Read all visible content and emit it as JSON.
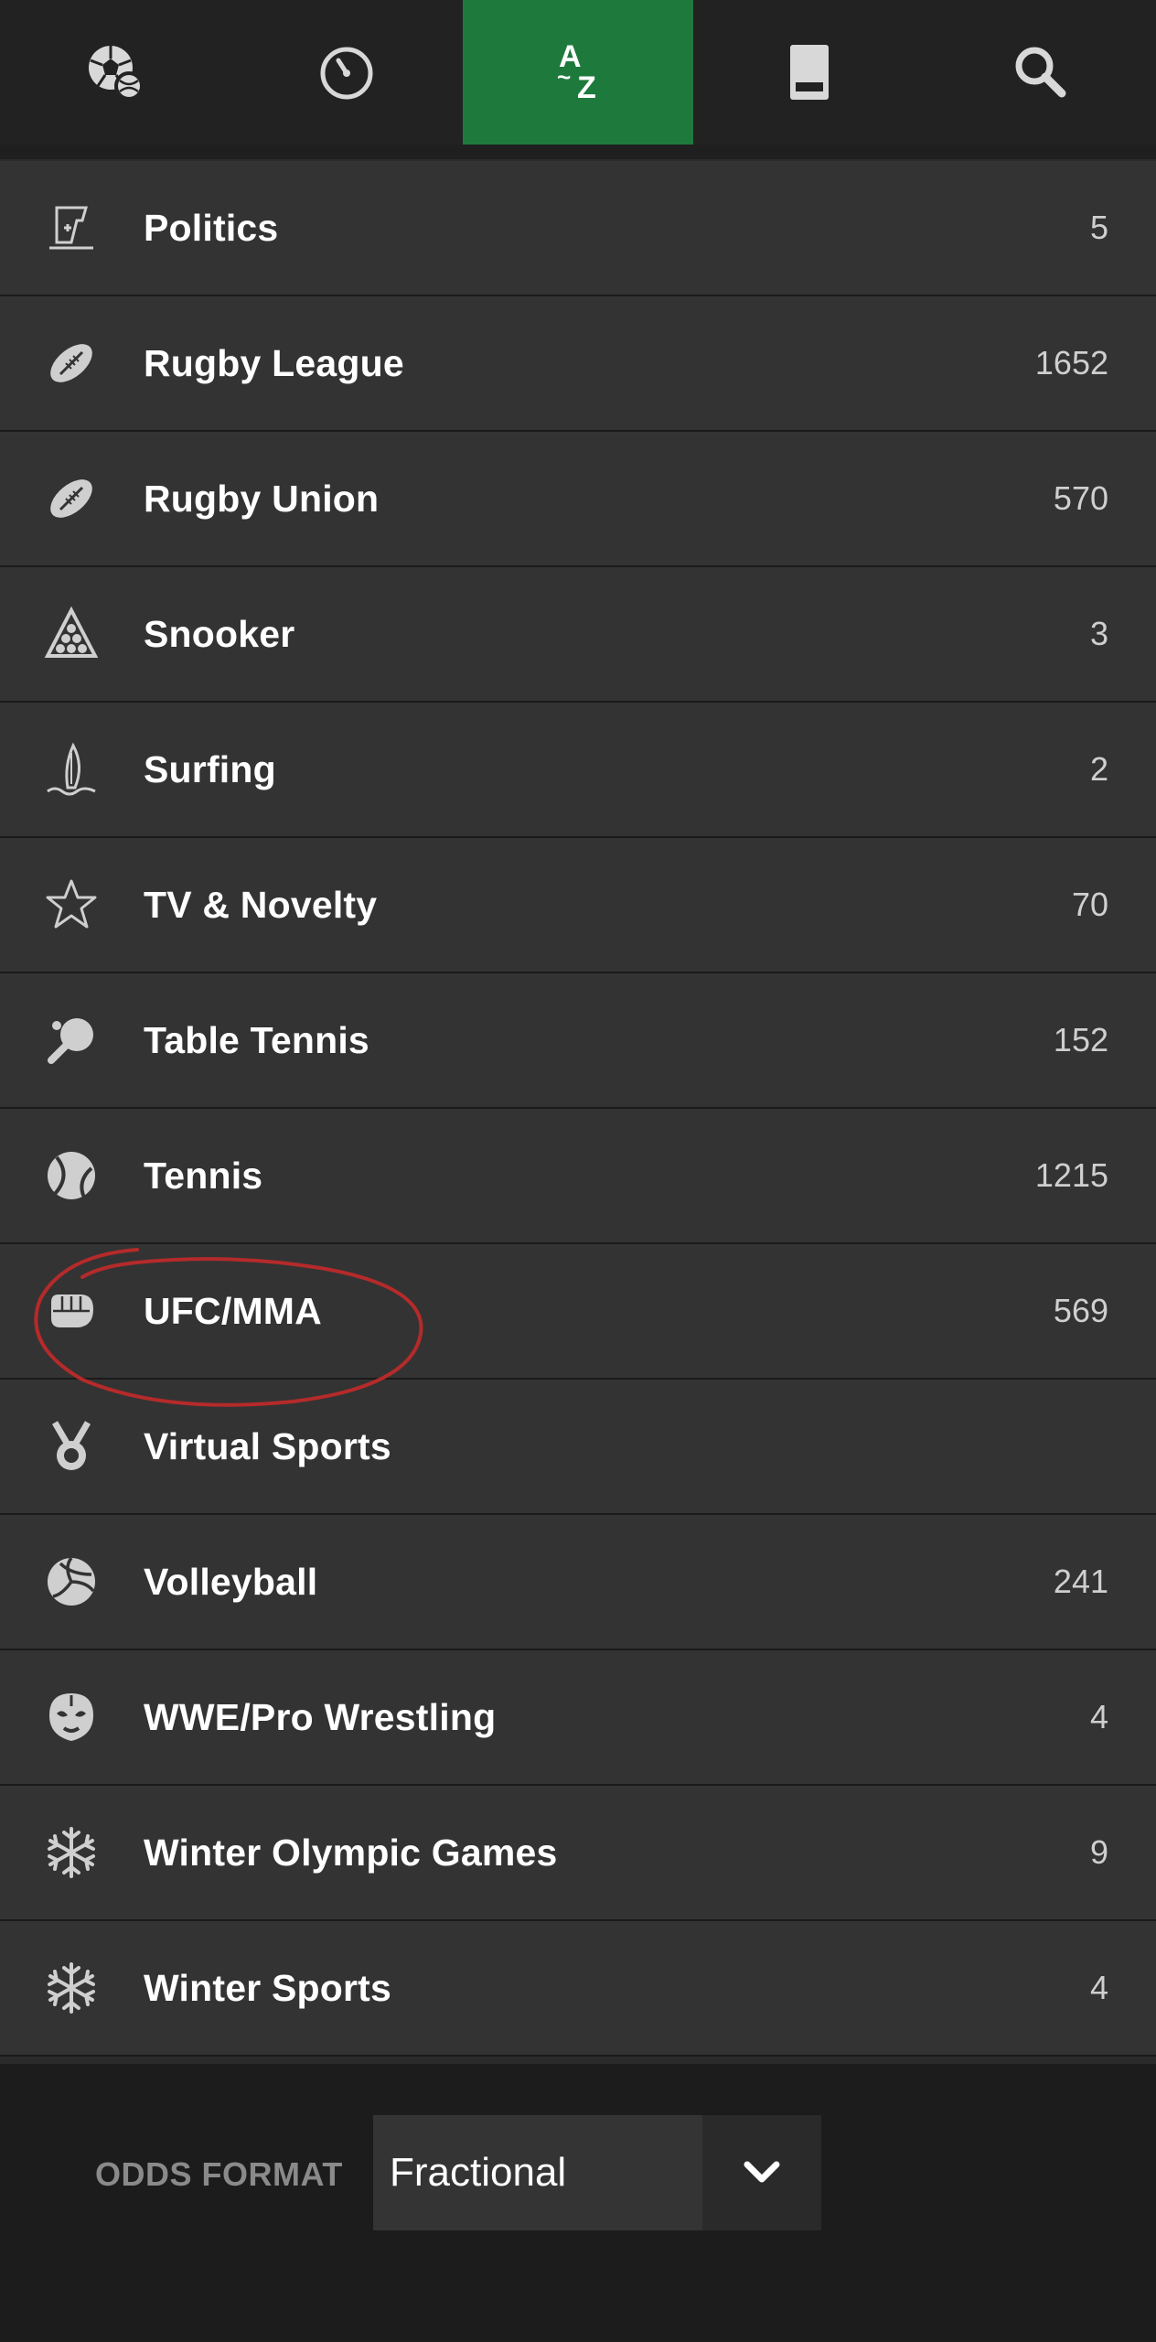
{
  "nav": {
    "tabs": [
      {
        "icon": "sports-ball-icon",
        "active": false
      },
      {
        "icon": "in-play-clock-icon",
        "active": false
      },
      {
        "icon": "a-z-icon",
        "active": true,
        "label_top": "A",
        "label_mid": "~",
        "label_bottom": "Z"
      },
      {
        "icon": "betslip-icon",
        "active": false
      },
      {
        "icon": "search-icon",
        "active": false
      }
    ],
    "active_color": "#1e7a3c"
  },
  "sports": [
    {
      "name": "Politics",
      "count": "5",
      "icon": "politics-icon"
    },
    {
      "name": "Rugby League",
      "count": "1652",
      "icon": "rugby-ball-icon"
    },
    {
      "name": "Rugby Union",
      "count": "570",
      "icon": "rugby-ball-icon"
    },
    {
      "name": "Snooker",
      "count": "3",
      "icon": "snooker-triangle-icon"
    },
    {
      "name": "Surfing",
      "count": "2",
      "icon": "surfboard-icon"
    },
    {
      "name": "TV & Novelty",
      "count": "70",
      "icon": "star-icon"
    },
    {
      "name": "Table Tennis",
      "count": "152",
      "icon": "table-tennis-paddle-icon"
    },
    {
      "name": "Tennis",
      "count": "1215",
      "icon": "tennis-ball-icon"
    },
    {
      "name": "UFC/MMA",
      "count": "569",
      "icon": "fist-icon"
    },
    {
      "name": "Virtual Sports",
      "count": "",
      "icon": "medal-icon"
    },
    {
      "name": "Volleyball",
      "count": "241",
      "icon": "volleyball-icon"
    },
    {
      "name": "WWE/Pro Wrestling",
      "count": "4",
      "icon": "wrestling-mask-icon"
    },
    {
      "name": "Winter Olympic Games",
      "count": "9",
      "icon": "snowflake-icon"
    },
    {
      "name": "Winter Sports",
      "count": "4",
      "icon": "snowflake-icon"
    }
  ],
  "annotation": {
    "color": "#b52a2a",
    "target": "UFC/MMA"
  },
  "footer": {
    "odds_label": "ODDS FORMAT",
    "odds_value": "Fractional"
  }
}
